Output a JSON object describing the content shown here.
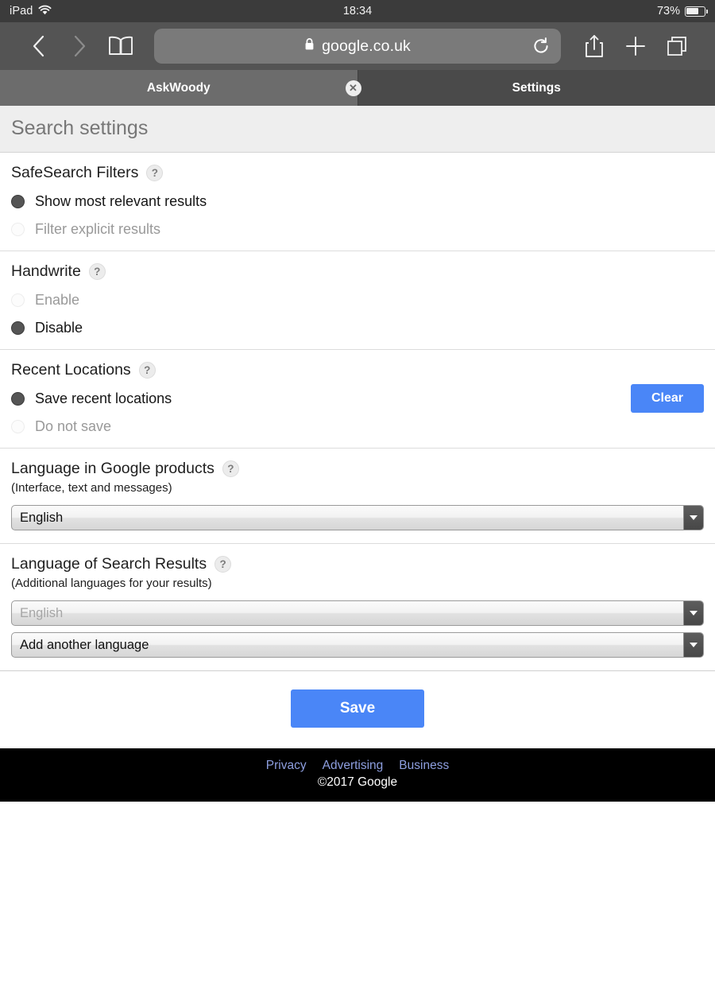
{
  "status_bar": {
    "device": "iPad",
    "wifi_icon": "wifi-icon",
    "time": "18:34",
    "battery_percent": "73%",
    "battery_icon": "battery-icon"
  },
  "browser": {
    "back_icon": "chevron-left-icon",
    "forward_icon": "chevron-right-icon",
    "bookmarks_icon": "book-icon",
    "lock_icon": "lock-icon",
    "url": "google.co.uk",
    "reload_icon": "reload-icon",
    "share_icon": "share-icon",
    "new_tab_icon": "plus-icon",
    "tabs_icon": "tabs-overview-icon",
    "tabs": [
      {
        "label": "AskWoody",
        "active": false
      },
      {
        "label": "Settings",
        "active": true
      }
    ],
    "close_tab_icon": "close-circle-icon"
  },
  "page": {
    "title": "Search settings",
    "help_glyph": "?",
    "sections": [
      {
        "title": "SafeSearch Filters",
        "options": [
          {
            "label": "Show most relevant results",
            "selected": true
          },
          {
            "label": "Filter explicit results",
            "selected": false
          }
        ]
      },
      {
        "title": "Handwrite",
        "options": [
          {
            "label": "Enable",
            "selected": false
          },
          {
            "label": "Disable",
            "selected": true
          }
        ]
      },
      {
        "title": "Recent Locations",
        "clear_label": "Clear",
        "options": [
          {
            "label": "Save recent locations",
            "selected": true
          },
          {
            "label": "Do not save",
            "selected": false
          }
        ]
      },
      {
        "title": "Language in Google products",
        "subtitle": "(Interface, text and messages)",
        "select_value": "English"
      },
      {
        "title": "Language of Search Results",
        "subtitle": "(Additional languages for your results)",
        "select_value_1": "English",
        "select_value_2": "Add another language"
      }
    ],
    "save_label": "Save",
    "footer": {
      "links": [
        "Privacy",
        "Advertising",
        "Business"
      ],
      "copyright": "©2017 Google"
    }
  },
  "colors": {
    "accent_blue": "#4a86f7",
    "chrome_gray": "#545454",
    "footer_link": "#8e9fe0"
  }
}
